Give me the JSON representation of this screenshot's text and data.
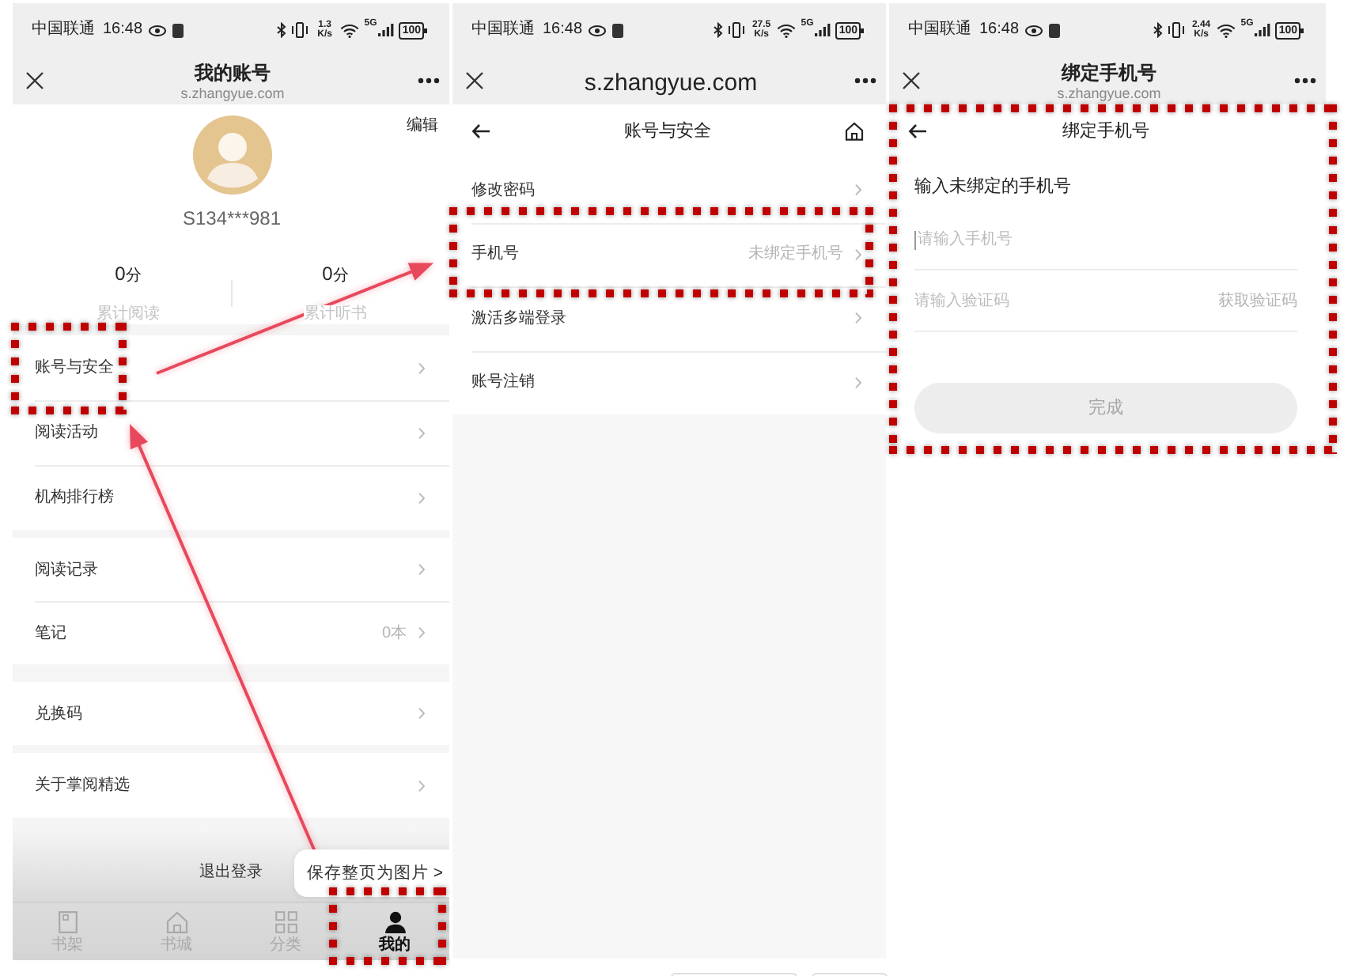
{
  "screens": [
    {
      "kind": "account",
      "status_bar": {
        "carrier": "中国联通",
        "time": "16:48",
        "speed": "1.3 K/s",
        "network": "5G",
        "battery": "100"
      },
      "header": {
        "title": "我的账号",
        "url": "s.zhangyue.com"
      },
      "profile": {
        "edit": "编辑",
        "username": "S134***981",
        "stats": [
          {
            "value": "0",
            "unit": "分",
            "label": "累计阅读"
          },
          {
            "value": "0",
            "unit": "分",
            "label": "累计听书"
          }
        ]
      },
      "menu_groups": [
        {
          "items": [
            {
              "label": "账号与安全",
              "highlighted": true
            },
            {
              "label": "阅读活动",
              "highlighted": false
            },
            {
              "label": "机构排行榜",
              "highlighted": false
            }
          ]
        },
        {
          "items": [
            {
              "label": "阅读记录",
              "highlighted": false
            },
            {
              "label": "笔记",
              "value": "0本",
              "highlighted": false
            }
          ]
        },
        {
          "items": [
            {
              "label": "兑换码",
              "highlighted": false
            }
          ]
        },
        {
          "items": [
            {
              "label": "关于掌阅精选",
              "highlighted": false
            }
          ]
        }
      ],
      "logout": "退出登录",
      "toast": "保存整页为图片 >",
      "tabs": [
        {
          "label": "书架",
          "selected": false,
          "highlighted": false
        },
        {
          "label": "书城",
          "selected": false,
          "highlighted": false
        },
        {
          "label": "分类",
          "selected": false,
          "highlighted": false
        },
        {
          "label": "我的",
          "selected": true,
          "highlighted": true
        }
      ]
    },
    {
      "kind": "security",
      "status_bar": {
        "carrier": "中国联通",
        "time": "16:48",
        "speed": "27.5 K/s",
        "network": "5G",
        "battery": "100"
      },
      "header": {
        "url": "s.zhangyue.com"
      },
      "subheader": {
        "title": "账号与安全",
        "home_button": true
      },
      "rows": [
        {
          "label": "修改密码",
          "highlighted": false
        },
        {
          "label": "手机号",
          "value": "未绑定手机号",
          "highlighted": true
        },
        {
          "label": "激活多端登录",
          "highlighted": false
        },
        {
          "label": "账号注销",
          "highlighted": false
        }
      ]
    },
    {
      "kind": "bind_phone",
      "status_bar": {
        "carrier": "中国联通",
        "time": "16:48",
        "speed": "2.44 K/s",
        "network": "5G",
        "battery": "100"
      },
      "header": {
        "title": "绑定手机号",
        "url": "s.zhangyue.com"
      },
      "subheader": {
        "title": "绑定手机号"
      },
      "form": {
        "highlighted": true,
        "heading": "输入未绑定的手机号",
        "phone": {
          "placeholder": "请输入手机号",
          "focused": true
        },
        "code": {
          "placeholder": "请输入验证码",
          "action": "获取验证码"
        },
        "submit": {
          "label": "完成",
          "disabled": true
        }
      }
    }
  ],
  "annotations": {
    "arrow_menu_to_row": true,
    "arrow_tab_to_menu": true
  }
}
